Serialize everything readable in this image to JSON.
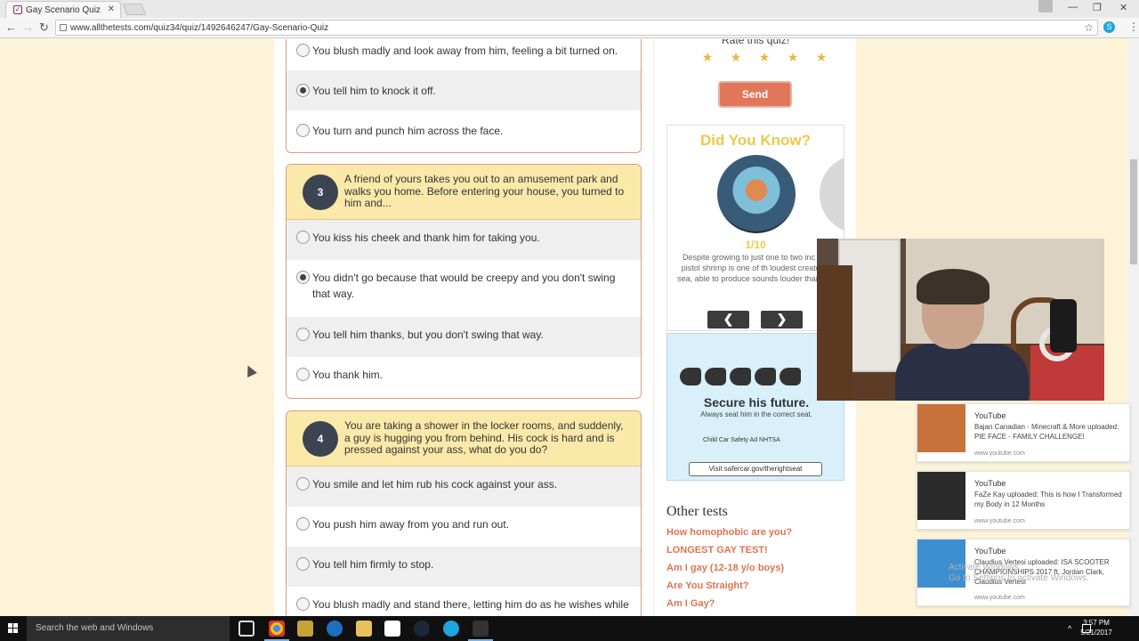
{
  "browser": {
    "tab_title": "Gay Scenario Quiz",
    "tab_close": "✕",
    "url": "www.allthetests.com/quiz34/quiz/1492646247/Gay-Scenario-Quiz",
    "win_minimize": "—",
    "win_restore": "❐",
    "win_close": "✕",
    "back": "←",
    "forward": "→",
    "reload": "↻",
    "bookmark": "☆",
    "menu": "⋮",
    "ext_skype": "S"
  },
  "quiz": {
    "q2_partial": {
      "options": [
        {
          "label": "You blush madly and look away from him, feeling a bit turned on.",
          "selected": false
        },
        {
          "label": "You tell him to knock it off.",
          "selected": true
        },
        {
          "label": "You turn and punch him across the face.",
          "selected": false
        }
      ]
    },
    "q3": {
      "number": "3",
      "text": "A friend of yours takes you out to an amusement park and walks you home. Before entering your house, you turned to him and...",
      "options": [
        {
          "label": "You kiss his cheek and thank him for taking you.",
          "selected": false
        },
        {
          "label": "You didn't go because that would be creepy and you don't swing that way.",
          "selected": true
        },
        {
          "label": "You tell him thanks, but you don't swing that way.",
          "selected": false
        },
        {
          "label": "You thank him.",
          "selected": false
        }
      ]
    },
    "q4": {
      "number": "4",
      "text": "You are taking a shower in the locker rooms, and suddenly, a guy is hugging you from behind. His cock is hard and is pressed against your ass, what do you do?",
      "options": [
        {
          "label": "You smile and let him rub his cock against your ass.",
          "selected": false
        },
        {
          "label": "You push him away from you and run out.",
          "selected": false
        },
        {
          "label": "You tell him firmly to stop.",
          "selected": false
        },
        {
          "label": "You blush madly and stand there, letting him do as he wishes while",
          "selected": false
        }
      ]
    }
  },
  "sidebar": {
    "rate_label": "Rate this quiz!",
    "stars": [
      "★",
      "★",
      "★",
      "★",
      "★"
    ],
    "send_label": "Send",
    "did_you_know": {
      "title": "Did You Know?",
      "counter": "1/10",
      "fact": "Despite growing to just one to two inc long, the pistol shrimp is one of th loudest creators of the sea, able to produce sounds louder than a jet eng",
      "prev": "❮",
      "next": "❯"
    },
    "ad": {
      "headline": "Secure his future.",
      "subline": "Always seat him in the correct seat.",
      "logos": "Child Car Safety  Ad  NHTSA",
      "link": "Visit safercar.gov/therightseat"
    },
    "other_tests": {
      "title": "Other tests",
      "links": [
        "How homophobic are you?",
        "LONGEST GAY TEST!",
        "Am I gay (12-18 y/o boys)",
        "Are You Straight?",
        "Am I Gay?"
      ]
    }
  },
  "notifications": [
    {
      "app": "YouTube",
      "message": "Bajan Canadian - Minecraft & More uploaded: PIE FACE - FAMILY CHALLENGE!",
      "source": "www.youtube.com",
      "thumb_color": "#c7713b"
    },
    {
      "app": "YouTube",
      "message": "FaZe Kay uploaded: This is how I Transformed my Body in 12 Months",
      "source": "www.youtube.com",
      "thumb_color": "#2b2b2b"
    },
    {
      "app": "YouTube",
      "message": "Claudius Vertesi uploaded: ISA SCOOTER CHAMPIONSHIPS 2017 ft. Jordan Clark, Claudius Vertesi",
      "source": "www.youtube.com",
      "thumb_color": "#3d8fd0"
    }
  ],
  "watermark": "Activate Windows\nGo to Settings to activate Windows.",
  "taskbar": {
    "search_placeholder": "Search the web and Windows",
    "time": "3:57 PM",
    "date": "5/21/2017"
  }
}
